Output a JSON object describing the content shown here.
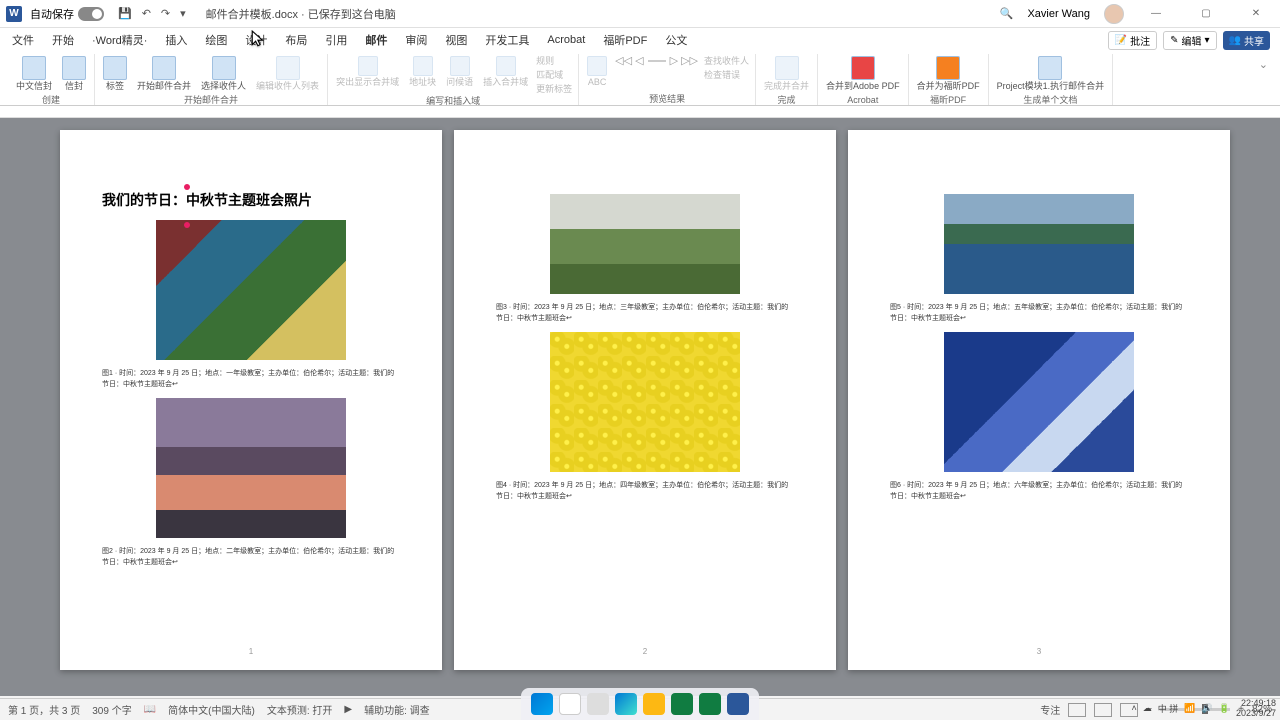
{
  "titlebar": {
    "autosave_label": "自动保存",
    "doc_name": "邮件合并模板.docx · 已保存到这台电脑",
    "user": "Xavier Wang"
  },
  "tabs": {
    "file": "文件",
    "home": "开始",
    "wordwizard": "·Word精灵·",
    "insert": "插入",
    "draw": "绘图",
    "design": "设计",
    "layout": "布局",
    "references": "引用",
    "mailings": "邮件",
    "review": "审阅",
    "view": "视图",
    "developer": "开发工具",
    "acrobat": "Acrobat",
    "foxit": "福昕PDF",
    "gongwen": "公文"
  },
  "tabs_right": {
    "track": "批注",
    "editing": "编辑",
    "share": "共享"
  },
  "ribbon": {
    "g1": {
      "cnenv": "中文信封",
      "env": "信封",
      "label": "创建"
    },
    "g2": {
      "tag": "标签",
      "start": "开始邮件合并",
      "select": "选择收件人",
      "edit": "编辑收件人列表",
      "label": "开始邮件合并"
    },
    "g3": {
      "highlight": "突出显示合并域",
      "addr": "地址块",
      "greeting": "问候语",
      "insertfield": "插入合并域",
      "rules": "规则",
      "match": "匹配域",
      "update": "更新标签",
      "label": "编写和插入域"
    },
    "g4": {
      "preview1": "检查错误",
      "preview2": "查找收件人",
      "first": "首记录",
      "label": "预览结果"
    },
    "g5": {
      "finish": "完成并合并",
      "label": "完成"
    },
    "g6": {
      "pdf1": "合并到Adobe PDF",
      "label": "Acrobat"
    },
    "g7": {
      "pdf2": "合并为福昕PDF",
      "label": "福昕PDF"
    },
    "g8": {
      "proj": "Project模块1.执行邮件合并",
      "label": "生成单个文档"
    }
  },
  "doc": {
    "title_prefix": "我们的节日：",
    "title_field": "中秋节主题班会照片",
    "cap1": "图1 · 时间：2023 年 9 月 25 日；地点：一年级教室；主办单位：伯伦希尔；活动主题：我们的节日：中秋节主题班会↩",
    "cap2": "图2 · 时间：2023 年 9 月 25 日；地点：二年级教室；主办单位：伯伦希尔；活动主题：我们的节日：中秋节主题班会↩",
    "cap3": "图3 · 时间：2023 年 9 月 25 日；地点：三年级教室；主办单位：伯伦希尔；活动主题：我们的节日：中秋节主题班会↩",
    "cap4": "图4 · 时间：2023 年 9 月 25 日；地点：四年级教室；主办单位：伯伦希尔；活动主题：我们的节日：中秋节主题班会↩",
    "cap5": "图5 · 时间：2023 年 9 月 25 日；地点：五年级教室；主办单位：伯伦希尔；活动主题：我们的节日：中秋节主题班会↩",
    "cap6": "图6 · 时间：2023 年 9 月 25 日；地点：六年级教室；主办单位：伯伦希尔；活动主题：我们的节日：中秋节主题班会↩",
    "p1": "1",
    "p2": "2",
    "p3": "3"
  },
  "status": {
    "page": "第 1 页，共 3 页",
    "words": "309 个字",
    "lang": "简体中文(中国大陆)",
    "pred": "文本预测: 打开",
    "acc": "辅助功能: 调查",
    "focus": "专注",
    "zoom": "82%"
  },
  "tray": {
    "ime": "中 拼",
    "time": "22:49:18",
    "date": "2023/9/27"
  }
}
